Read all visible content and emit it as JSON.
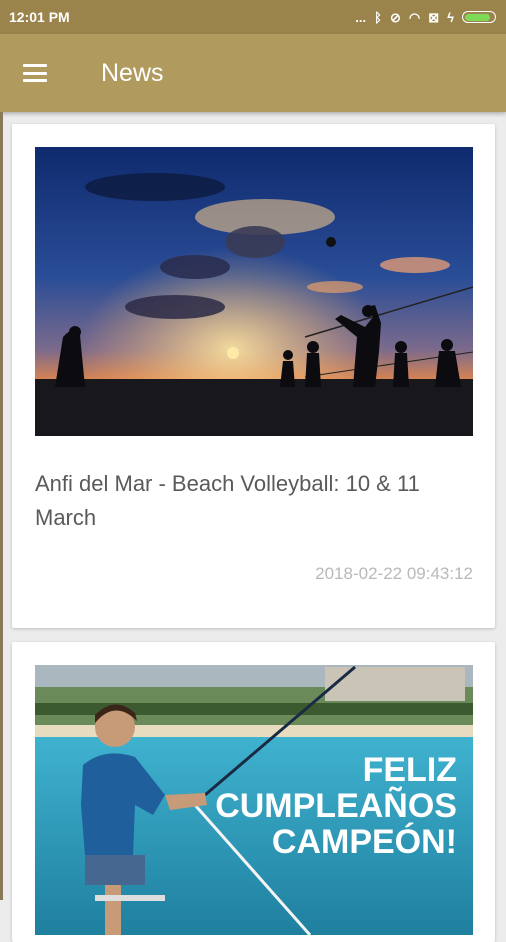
{
  "status_bar": {
    "time": "12:01 PM",
    "icons": [
      "dots-icon",
      "bluetooth-icon",
      "mute-icon",
      "wifi-icon",
      "sim-icon",
      "charging-icon",
      "battery-icon"
    ],
    "more_dots": "...",
    "battery_level": 0.9
  },
  "app_bar": {
    "title": "News",
    "menu_icon": "hamburger-menu-icon"
  },
  "news": [
    {
      "title": "Anfi del Mar - Beach Volleyball: 10 & 11 March",
      "date": "2018-02-22 09:43:12",
      "image": "beach-volleyball-sunset"
    },
    {
      "title": "",
      "date": "",
      "image": "fishing-birthday-promo",
      "image_text": [
        "FELIZ",
        "CUMPLEAÑOS",
        "CAMPEÓN!"
      ]
    }
  ],
  "colors": {
    "status_bar": "#9a844c",
    "app_bar": "#b09a5e",
    "background": "#ececec",
    "title_text": "#5a5a5a",
    "date_text": "#b9b9b9"
  }
}
